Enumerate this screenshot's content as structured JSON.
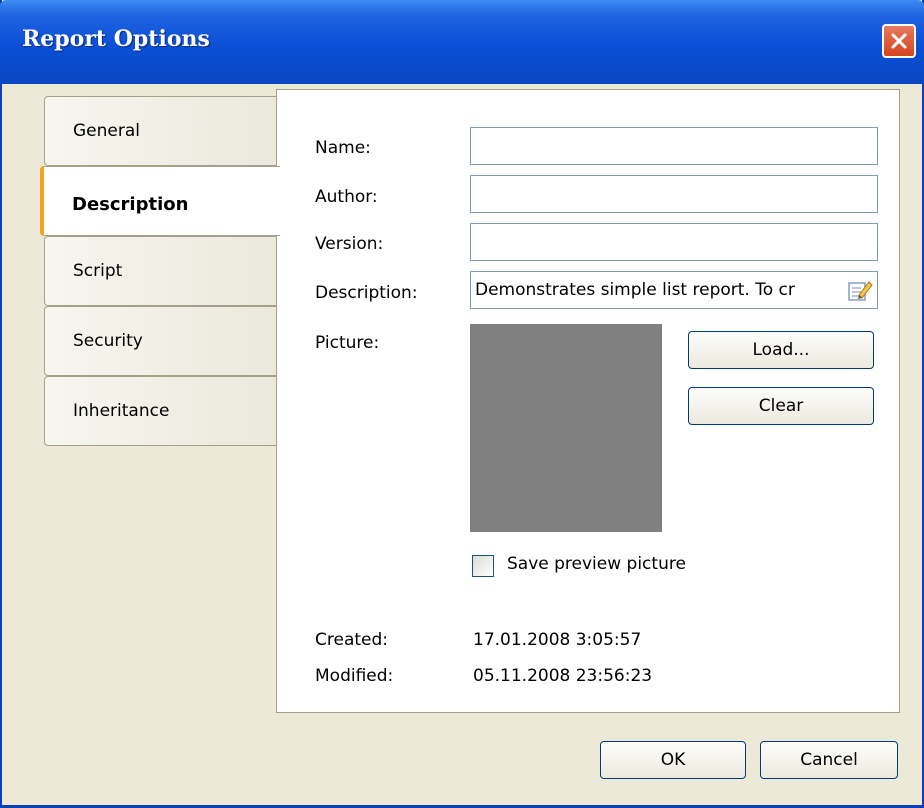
{
  "window": {
    "title": "Report Options"
  },
  "tabs": [
    {
      "label": "General",
      "active": false
    },
    {
      "label": "Description",
      "active": true
    },
    {
      "label": "Script",
      "active": false
    },
    {
      "label": "Security",
      "active": false
    },
    {
      "label": "Inheritance",
      "active": false
    }
  ],
  "form": {
    "name_label": "Name:",
    "name_value": "",
    "author_label": "Author:",
    "author_value": "",
    "version_label": "Version:",
    "version_value": "",
    "description_label": "Description:",
    "description_value": "Demonstrates simple list report. To cr",
    "picture_label": "Picture:",
    "load_label": "Load...",
    "clear_label": "Clear",
    "save_preview_label": "Save preview picture",
    "save_preview_checked": false,
    "created_label": "Created:",
    "created_value": "17.01.2008 3:05:57",
    "modified_label": "Modified:",
    "modified_value": "05.11.2008 23:56:23"
  },
  "footer": {
    "ok_label": "OK",
    "cancel_label": "Cancel"
  },
  "colors": {
    "titlebar": "#0a4fd6",
    "active_tab_accent": "#f2a31a",
    "picture_fill": "#808080",
    "close_button": "#d4431f"
  },
  "icons": {
    "close": "close-icon",
    "description_edit": "edit-note-icon"
  }
}
